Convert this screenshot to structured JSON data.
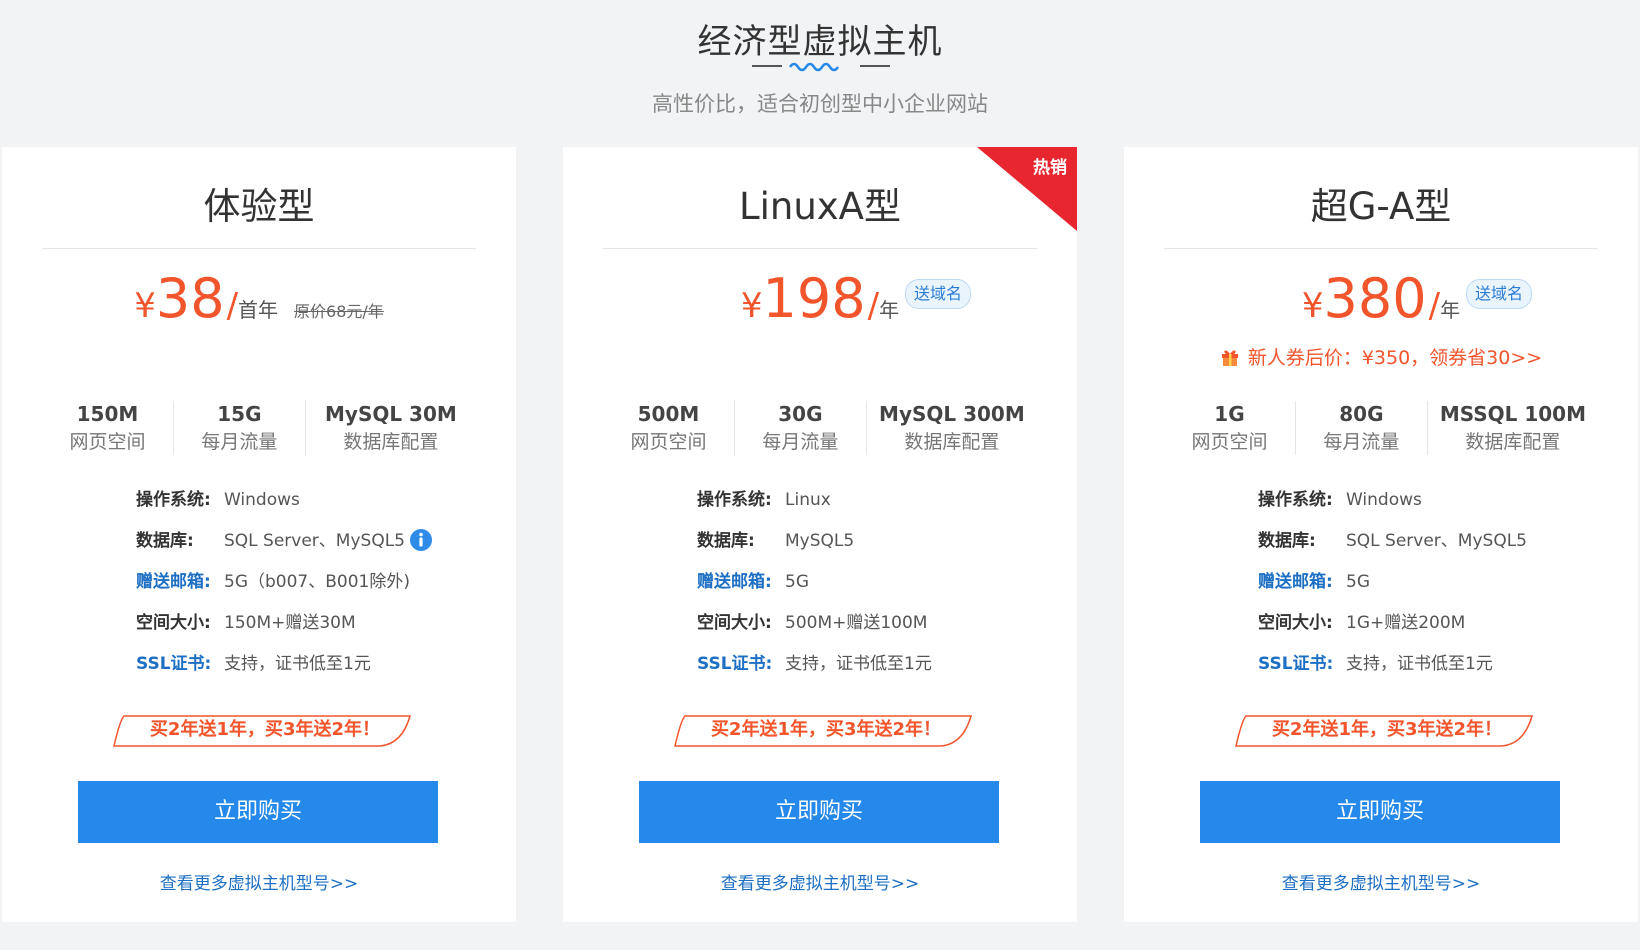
{
  "header": {
    "title": "经济型虚拟主机",
    "subtitle": "高性价比，适合初创型中小企业网站"
  },
  "colors": {
    "accent": "#2489ea",
    "price": "#f2552c",
    "link": "#1d6fc4",
    "hot": "#e8262f"
  },
  "labels": {
    "os": "操作系统:",
    "db": "数据库:",
    "mail": "赠送邮箱:",
    "space": "空间大小:",
    "ssl": "SSL证书:",
    "offer": "买2年送1年，买3年送2年！",
    "buy": "立即购买",
    "more": "查看更多虚拟主机型号>>",
    "domain_tag": "送域名",
    "currency": "¥"
  },
  "plans": [
    {
      "name": "体验型",
      "price": "38",
      "unit": "首年",
      "original": "原价68元/年",
      "specs": [
        {
          "value": "150M",
          "label": "网页空间"
        },
        {
          "value": "15G",
          "label": "每月流量"
        },
        {
          "value": "MySQL 30M",
          "label": "数据库配置"
        }
      ],
      "os": "Windows",
      "db": "SQL Server、MySQL5",
      "mail": "5G（b007、B001除外)",
      "space": "150M+赠送30M",
      "ssl": "支持，证书低至1元"
    },
    {
      "name": "LinuxA型",
      "price": "198",
      "unit": "年",
      "badge": "热销",
      "specs": [
        {
          "value": "500M",
          "label": "网页空间"
        },
        {
          "value": "30G",
          "label": "每月流量"
        },
        {
          "value": "MySQL 300M",
          "label": "数据库配置"
        }
      ],
      "os": "Linux",
      "db": "MySQL5",
      "mail": "5G",
      "space": "500M+赠送100M",
      "ssl": "支持，证书低至1元"
    },
    {
      "name": "超G-A型",
      "price": "380",
      "unit": "年",
      "promo": "新人券后价：¥350，领券省30>>",
      "specs": [
        {
          "value": "1G",
          "label": "网页空间"
        },
        {
          "value": "80G",
          "label": "每月流量"
        },
        {
          "value": "MSSQL 100M",
          "label": "数据库配置"
        }
      ],
      "os": "Windows",
      "db": "SQL Server、MySQL5",
      "mail": "5G",
      "space": "1G+赠送200M",
      "ssl": "支持，证书低至1元"
    }
  ]
}
